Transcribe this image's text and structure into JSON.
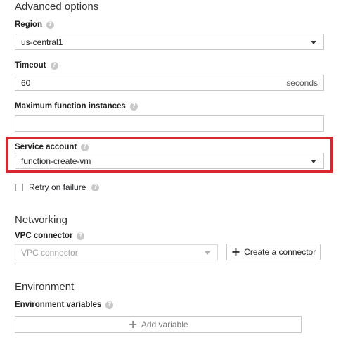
{
  "advanced": {
    "title": "Advanced options",
    "region": {
      "label": "Region",
      "value": "us-central1"
    },
    "timeout": {
      "label": "Timeout",
      "value": "60",
      "suffix": "seconds"
    },
    "max_instances": {
      "label": "Maximum function instances",
      "value": ""
    },
    "service_account": {
      "label": "Service account",
      "value": "function-create-vm"
    },
    "retry": {
      "label": "Retry on failure",
      "checked": false
    }
  },
  "networking": {
    "title": "Networking",
    "vpc": {
      "label": "VPC connector",
      "placeholder": "VPC connector"
    },
    "create_button": "Create a connector"
  },
  "environment": {
    "title": "Environment",
    "variables_label": "Environment variables",
    "add_button": "Add variable"
  },
  "colors": {
    "highlight": "#d8262e"
  },
  "icons": [
    "help-icon",
    "dropdown-caret-icon",
    "plus-icon",
    "checkbox"
  ]
}
